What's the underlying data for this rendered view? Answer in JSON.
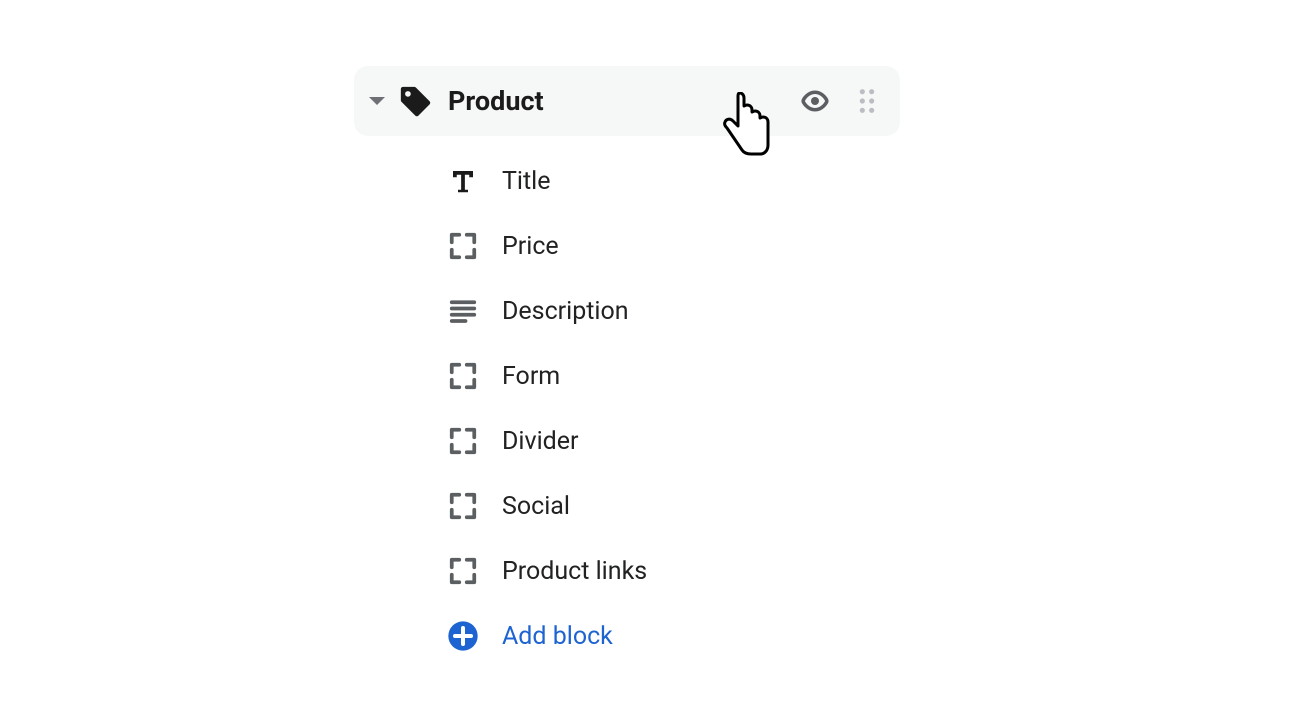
{
  "section": {
    "label": "Product",
    "expanded": true,
    "visible": true
  },
  "blocks": [
    {
      "icon": "text",
      "label": "Title"
    },
    {
      "icon": "placeholder",
      "label": "Price"
    },
    {
      "icon": "paragraph",
      "label": "Description"
    },
    {
      "icon": "placeholder",
      "label": "Form"
    },
    {
      "icon": "placeholder",
      "label": "Divider"
    },
    {
      "icon": "placeholder",
      "label": "Social"
    },
    {
      "icon": "placeholder",
      "label": "Product links"
    }
  ],
  "add": {
    "label": "Add block"
  },
  "colors": {
    "link": "#1d63d1",
    "muted": "#5c5f62",
    "panelBg": "#f6f7f7"
  }
}
